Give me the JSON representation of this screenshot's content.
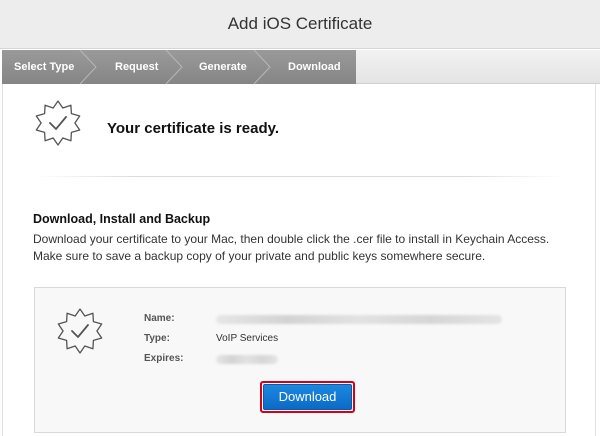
{
  "header": {
    "title": "Add iOS Certificate"
  },
  "steps": [
    {
      "label": "Select Type"
    },
    {
      "label": "Request"
    },
    {
      "label": "Generate"
    },
    {
      "label": "Download"
    }
  ],
  "ready": {
    "message": "Your certificate is ready."
  },
  "instructions": {
    "title": "Download, Install and Backup",
    "line1": "Download your certificate to your Mac, then double click the .cer file to install in Keychain Access.",
    "line2": "Make sure to save a backup copy of your private and public keys somewhere secure."
  },
  "certificate": {
    "name_label": "Name:",
    "type_label": "Type:",
    "type_value": "VoIP Services",
    "expires_label": "Expires:"
  },
  "download_button": {
    "label": "Download",
    "highlight_color": "#d0021b"
  },
  "colors": {
    "accent": "#0a6bc6",
    "steps_active": "#8e8e8e"
  },
  "icons": {
    "certificate": "certificate-badge-check-icon"
  }
}
